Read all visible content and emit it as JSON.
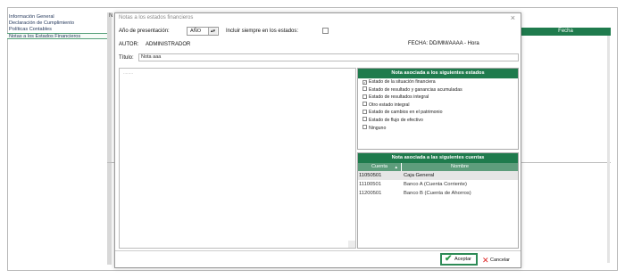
{
  "sidebar": {
    "items": [
      {
        "label": "Información General"
      },
      {
        "label": "Declaración de Cumplimiento"
      },
      {
        "label": "Políticas Contables"
      },
      {
        "label": "Notas a los Estados Financieros"
      }
    ]
  },
  "background": {
    "tab_prefix": "N",
    "column_header": "Fecha"
  },
  "dialog": {
    "title": "Notas a los estados financieros",
    "close_glyph": "×",
    "year_label": "Año de presentación:",
    "year_value": "AÑO",
    "include_label": "Incluir siempre en los estados:",
    "autor_label": "AUTOR:",
    "autor_value": "ADMINISTRADOR",
    "fecha_label": "FECHA: DD/MM/AAAA - Hora",
    "titulo_label": "Título:",
    "titulo_value": "Nota aaa",
    "editor_text": "........",
    "states_header": "Nota asociada a los siguientes estados",
    "states": [
      {
        "label": "Estado de la situación financiera",
        "checked": true
      },
      {
        "label": "Estado de resultado y ganancias acumuladas",
        "checked": false
      },
      {
        "label": "Estado de resultados integral",
        "checked": false
      },
      {
        "label": "Otro estado integral",
        "checked": false
      },
      {
        "label": "Estado de cambios en el patrimonio",
        "checked": false
      },
      {
        "label": "Estado de flujo de efectivo",
        "checked": false
      },
      {
        "label": "Ninguno",
        "checked": false
      }
    ],
    "accounts_header": "Nota asociada a las siguientes cuentas",
    "accounts_columns": {
      "code": "Cuenta",
      "name": "Nombre"
    },
    "accounts": [
      {
        "code": "11050501",
        "name": "Caja General"
      },
      {
        "code": "11100501",
        "name": "Banco A (Cuenta Corriente)"
      },
      {
        "code": "11200501",
        "name": "Banco B (Cuenta de Ahorros)"
      }
    ],
    "accept_label": "Aceptar",
    "cancel_label": "Cancelar"
  },
  "colors": {
    "accent": "#1f7b4d",
    "accent_light": "#5e9d7c",
    "cancel": "#dd2222"
  }
}
